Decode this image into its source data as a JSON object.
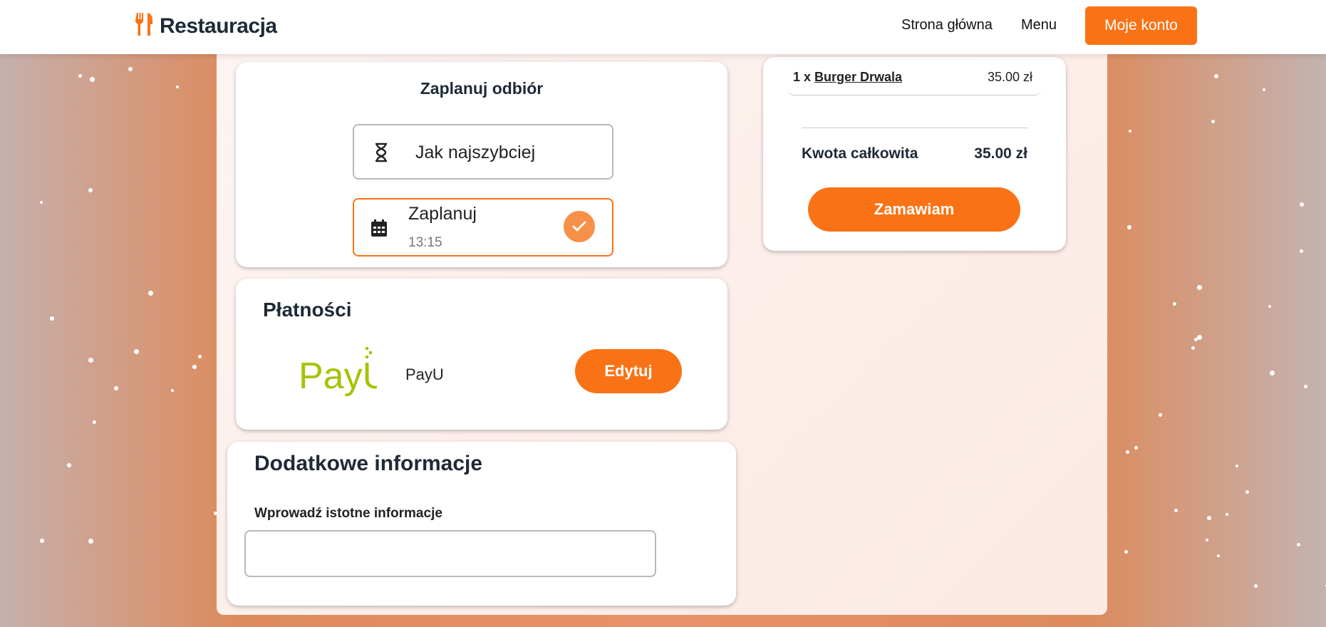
{
  "header": {
    "brand": "Restauracja",
    "nav": [
      {
        "label": "Strona główna"
      },
      {
        "label": "Menu"
      }
    ],
    "account_button": "Moje konto",
    "accent_color": "#f97316"
  },
  "pickup": {
    "title": "Zaplanuj odbiór",
    "options": [
      {
        "label": "Jak najszybciej",
        "icon": "hourglass-icon"
      },
      {
        "label": "Zaplanuj",
        "time": "13:15",
        "icon": "calendar-icon",
        "selected": true
      }
    ]
  },
  "payments": {
    "title": "Płatności",
    "method_logo": "PayU",
    "method_name": "PayU",
    "edit_button": "Edytuj"
  },
  "additional": {
    "title": "Dodatkowe informacje",
    "field_label": "Wprowadź istotne informacje",
    "field_value": ""
  },
  "order": {
    "items": [
      {
        "qty": "1 x",
        "name": "Burger Drwala",
        "price": "35.00 zł"
      }
    ],
    "total_label": "Kwota całkowita",
    "total_value": "35.00 zł",
    "submit_button": "Zamawiam"
  }
}
